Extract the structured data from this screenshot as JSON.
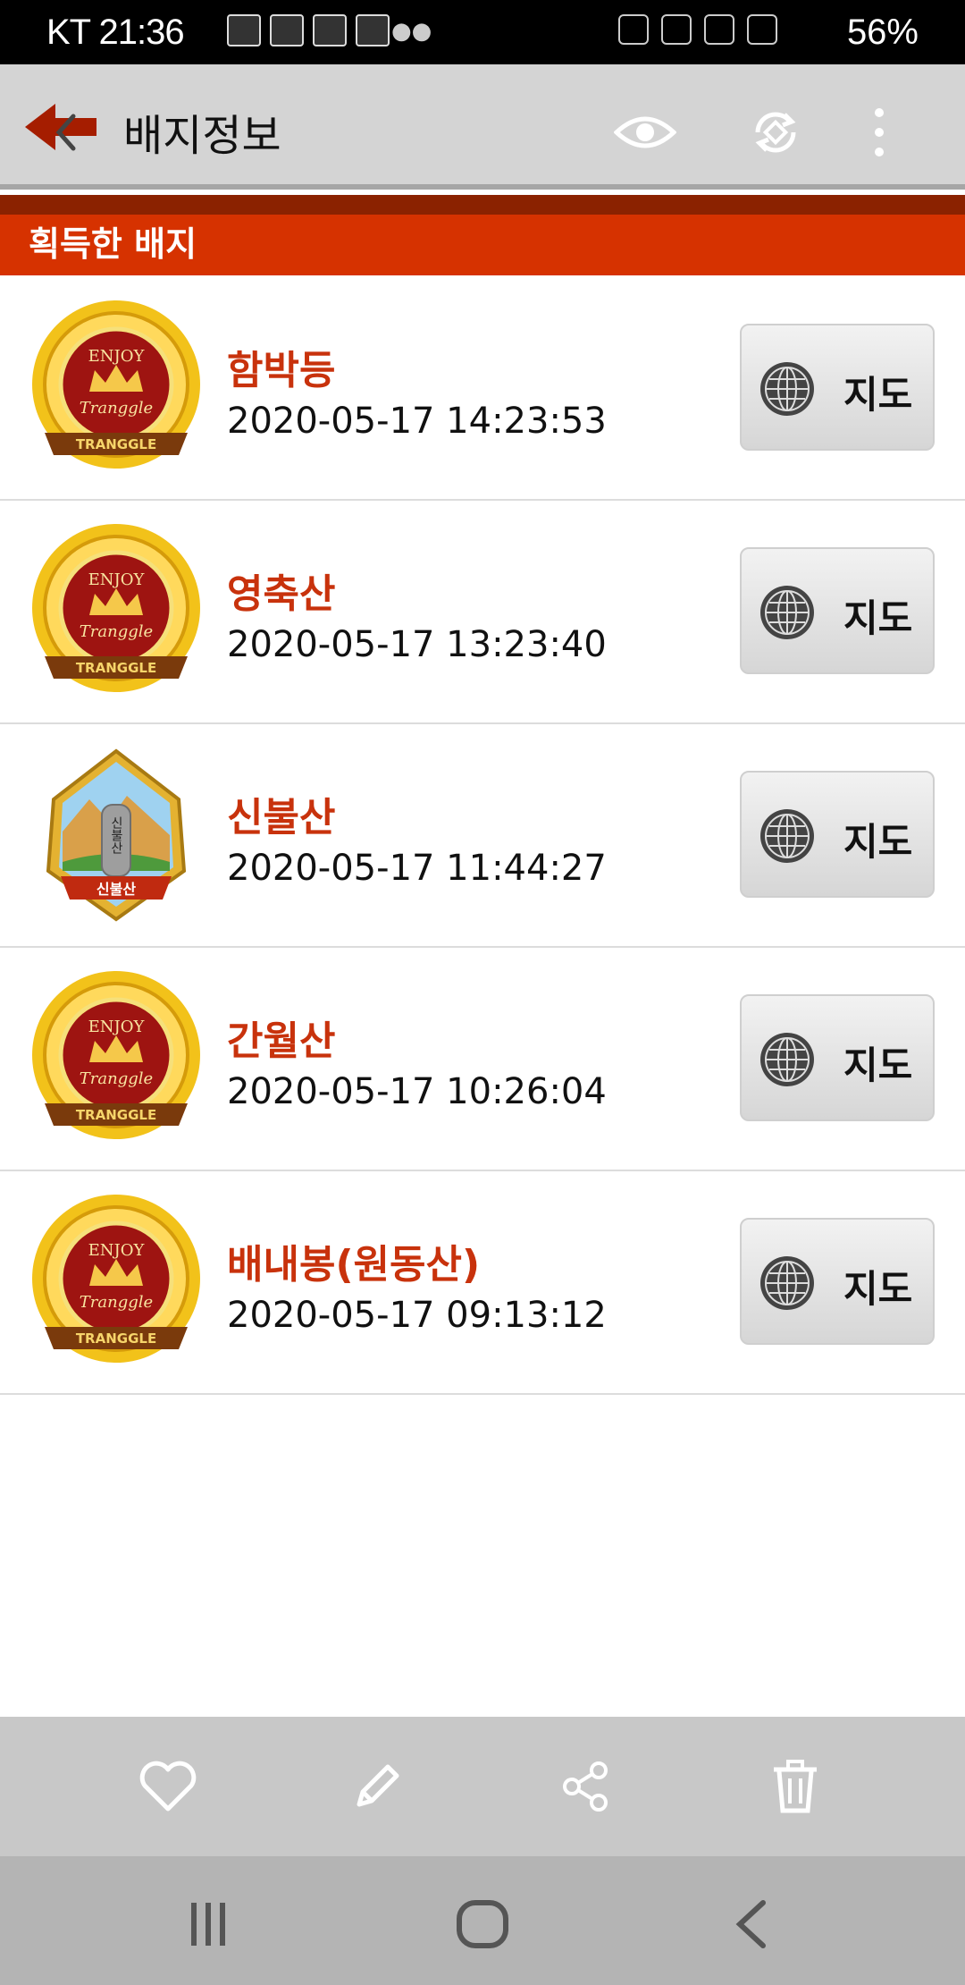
{
  "status_bar": {
    "carrier": "KT 21:36",
    "battery": "56%"
  },
  "toolbar": {
    "title": "배지정보",
    "icons": [
      "back-arrow-icon",
      "eye-icon",
      "sync-icon",
      "more-vert-icon"
    ]
  },
  "section": {
    "label": "획득한 배지"
  },
  "badges": [
    {
      "name": "함박등",
      "time": "2020-05-17 14:23:53",
      "map_label": "지도",
      "badge_type": "enjoy-tranggle"
    },
    {
      "name": "영축산",
      "time": "2020-05-17 13:23:40",
      "map_label": "지도",
      "badge_type": "enjoy-tranggle"
    },
    {
      "name": "신불산",
      "time": "2020-05-17 11:44:27",
      "map_label": "지도",
      "badge_type": "mountain"
    },
    {
      "name": "간월산",
      "time": "2020-05-17 10:26:04",
      "map_label": "지도",
      "badge_type": "enjoy-tranggle"
    },
    {
      "name": "배내봉(원동산)",
      "time": "2020-05-17 09:13:12",
      "map_label": "지도",
      "badge_type": "enjoy-tranggle"
    }
  ],
  "badge_art": {
    "enjoy": "ENJOY",
    "tranggle_script": "Tranggle",
    "tranggle_ribbon": "TRANGGLE",
    "mountain_ribbon": "신불산",
    "mountain_stone": "신불산"
  },
  "action_bar": {
    "icons": [
      "heart-icon",
      "pencil-icon",
      "share-icon",
      "trash-icon"
    ]
  },
  "nav_bar": {
    "icons": [
      "recents-icon",
      "home-icon",
      "back-icon"
    ]
  },
  "colors": {
    "accent": "#d63200",
    "badge_name": "#c8320c",
    "toolbar_bg": "#d4d4d4"
  }
}
